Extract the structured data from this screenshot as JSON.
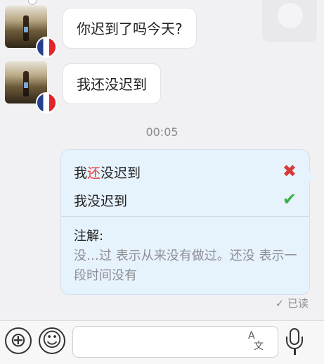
{
  "messages": [
    {
      "text": "你迟到了吗今天?"
    },
    {
      "text": "我还没迟到"
    }
  ],
  "timestamp": "00:05",
  "correction": {
    "wrong_before": "我",
    "wrong_highlight": "还",
    "wrong_after": "没迟到",
    "wrong_mark": "✖",
    "right": "我没迟到",
    "right_mark": "✔",
    "note_title": "注解:",
    "note_body": "没…过 表示从来没有做过。还没 表示一段时间没有"
  },
  "read_status": "✓ 已读",
  "toolbar": {
    "add_icon": "⊕",
    "emoji_icon": "☺",
    "input_value": "",
    "translate_top": "A",
    "translate_bottom": "文"
  },
  "colors": {
    "correction_bg": "#e6f2fc",
    "wrong": "#e53d37",
    "right": "#3cb14a"
  }
}
